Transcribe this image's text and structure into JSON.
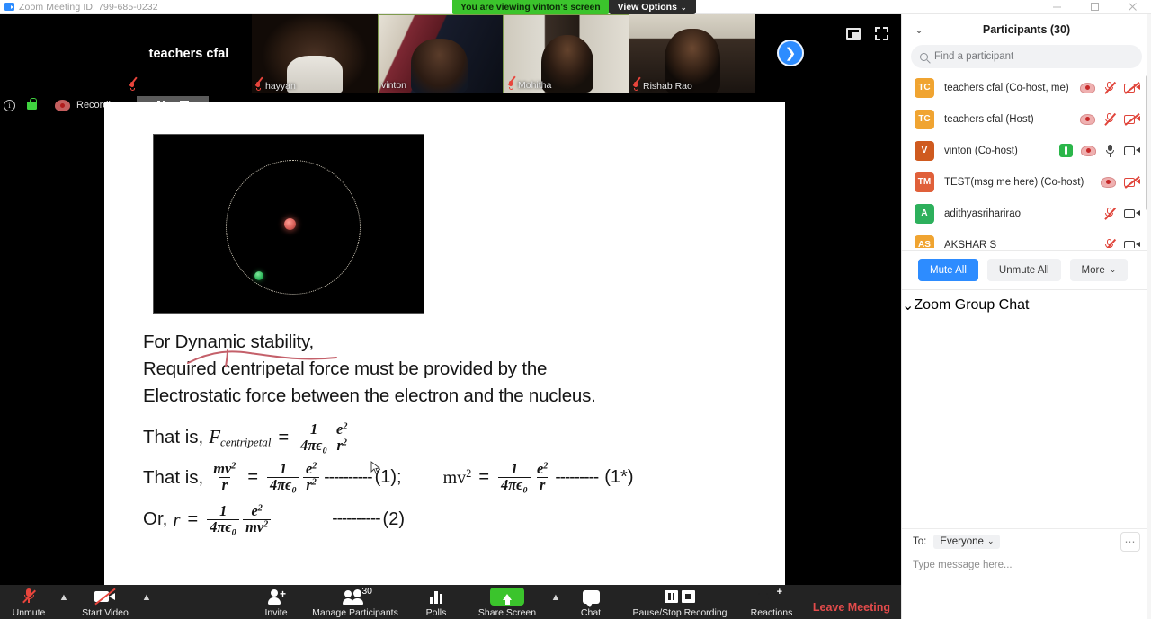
{
  "window": {
    "title": "Zoom Meeting ID: 799-685-0232",
    "minimize": "minimize",
    "maximize": "maximize",
    "close": "close"
  },
  "view_banner": {
    "message": "You are viewing vinton's screen",
    "options_label": "View Options",
    "caret": "⌄",
    "green": "#3bc42c"
  },
  "filmstrip": {
    "tiles": [
      {
        "name": "teachers cfal",
        "muted": true,
        "big_label": true,
        "speaking": false
      },
      {
        "name": "hayyan",
        "muted": true,
        "big_label": false,
        "speaking": false
      },
      {
        "name": "vinton",
        "muted": false,
        "big_label": false,
        "speaking": true
      },
      {
        "name": "Mohitha",
        "muted": true,
        "big_label": false,
        "speaking": true
      },
      {
        "name": "Rishab Rao",
        "muted": true,
        "big_label": false,
        "speaking": false
      }
    ],
    "next_icon": "chevron-right-icon",
    "pip_icon": "picture-in-picture-icon",
    "fullscreen_icon": "fullscreen-icon"
  },
  "recording_bar": {
    "info_icon": "info-icon",
    "lock_icon": "encryption-lock-icon",
    "record_icon": "recording-icon",
    "status": "Recording...",
    "pause_icon": "pause-icon",
    "stop_icon": "stop-icon"
  },
  "slide": {
    "diagram": {
      "label": "bohr-atom-orbit-diagram",
      "nucleus_color": "#d9615a",
      "electron_color": "#28b457"
    },
    "lines": [
      "For Dynamic stability,",
      "Required centripetal force must be provided by the",
      "Electrostatic force between the electron and the nucleus."
    ],
    "equations": [
      {
        "lead": "That is,",
        "lhs": "F",
        "lhs_sub": "centripetal",
        "eq": "=",
        "frac1_num": "1",
        "frac1_den": "4πϵ₀",
        "frac2_num": "e",
        "frac2_num_sup": "2",
        "frac2_den": "r",
        "frac2_den_sup": "2",
        "dashes": "",
        "tag": ""
      },
      {
        "lead": "That is,",
        "lhs_frac_num": "mv",
        "lhs_frac_num_sup": "2",
        "lhs_frac_den": "r",
        "eq": "=",
        "frac1_num": "1",
        "frac1_den": "4πϵ₀",
        "frac2_num": "e",
        "frac2_num_sup": "2",
        "frac2_den": "r",
        "frac2_den_sup": "2",
        "dashes": "----------",
        "tag": "(1);"
      },
      {
        "lead": "",
        "lhs": "mv",
        "lhs_sup": "2",
        "eq": "=",
        "frac1_num": "1",
        "frac1_den": "4πϵ₀",
        "frac2_num": "e",
        "frac2_num_sup": "2",
        "frac2_den": "r",
        "frac2_den_sup": "",
        "dashes": "---------",
        "tag": "(1*)"
      },
      {
        "lead": "Or,",
        "lhs": "r",
        "eq": "=",
        "frac1_num": "1",
        "frac1_den": "4πϵ₀",
        "frac2_num": "e",
        "frac2_num_sup": "2",
        "frac2_den": "mv",
        "frac2_den_sup": "2",
        "dashes": "----------",
        "tag": "(2)"
      }
    ],
    "annotation_color": "#c4606a"
  },
  "toolbar": {
    "items": [
      {
        "label": "Unmute",
        "icon": "mic-off-icon",
        "caret": true
      },
      {
        "label": "Start Video",
        "icon": "camera-off-icon",
        "caret": true
      },
      {
        "label": "Invite",
        "icon": "invite-person-icon",
        "caret": false
      },
      {
        "label": "Manage Participants",
        "icon": "participants-icon",
        "caret": false,
        "badge": "30"
      },
      {
        "label": "Polls",
        "icon": "polls-bar-icon",
        "caret": false
      },
      {
        "label": "Share Screen",
        "icon": "share-screen-icon",
        "caret": true
      },
      {
        "label": "Chat",
        "icon": "chat-bubble-icon",
        "caret": false
      },
      {
        "label": "Pause/Stop Recording",
        "icon": "pause-stop-recording-icon",
        "caret": false
      },
      {
        "label": "Reactions",
        "icon": "reactions-smiley-icon",
        "caret": false
      }
    ],
    "leave_label": "Leave Meeting",
    "leave_color": "#e34b4b"
  },
  "sidebar": {
    "participants_panel": {
      "title": "Participants (30)",
      "collapse_icon": "chevron-down-icon",
      "search_placeholder": "Find a participant",
      "search_value": "",
      "search_icon": "search-icon",
      "rows": [
        {
          "initials": "TC",
          "color": "#f0a431",
          "name": "teachers cfal (Co-host, me)",
          "icons": [
            "record-cloud-icon",
            "mic-off-icon",
            "camera-off-icon"
          ]
        },
        {
          "initials": "TC",
          "color": "#f0a431",
          "name": "teachers cfal (Host)",
          "icons": [
            "record-cloud-icon",
            "mic-off-icon",
            "camera-off-icon"
          ]
        },
        {
          "initials": "V",
          "color": "#cf5a1f",
          "name": "vinton (Co-host)",
          "icons": [
            "raise-hand-icon",
            "record-cloud-icon",
            "mic-on-icon",
            "camera-on-icon"
          ]
        },
        {
          "initials": "TM",
          "color": "#e0603a",
          "name": "TEST(msg me here) (Co-host)",
          "icons": [
            "record-cloud-icon",
            "camera-off-icon"
          ]
        },
        {
          "initials": "A",
          "color": "#2db05c",
          "name": "adithyasriharirao",
          "icons": [
            "mic-off-icon",
            "camera-on-icon"
          ]
        },
        {
          "initials": "AS",
          "color": "#f0a431",
          "name": "AKSHAR S",
          "icons": [
            "mic-off-icon",
            "camera-on-icon"
          ]
        }
      ],
      "actions": [
        {
          "label": "Mute All",
          "style": "primary"
        },
        {
          "label": "Unmute All",
          "style": "plain"
        },
        {
          "label": "More",
          "style": "plain",
          "caret": "⌄"
        }
      ]
    },
    "chat_panel": {
      "title": "Zoom Group Chat",
      "collapse_icon": "chevron-down-icon",
      "to_label": "To:",
      "to_value": "Everyone",
      "to_caret": "⌄",
      "more_icon": "more-options-icon",
      "more_glyph": "⋯",
      "message_placeholder": "Type message here...",
      "message_value": ""
    }
  }
}
